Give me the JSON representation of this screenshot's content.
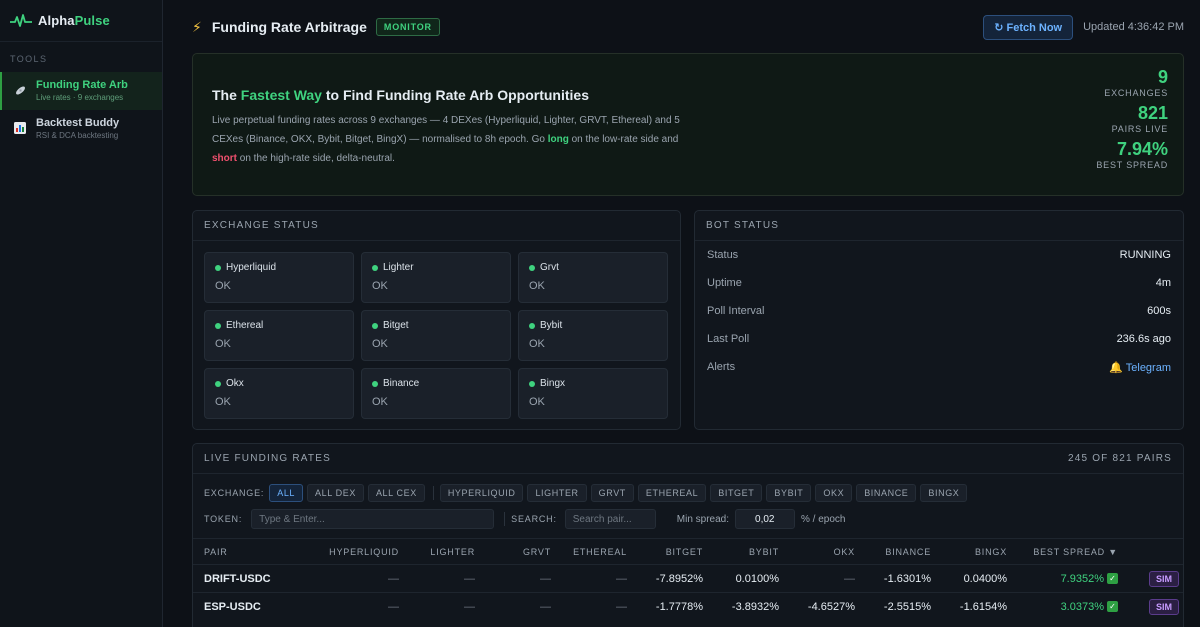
{
  "brand": {
    "name_a": "Alpha",
    "name_b": "Pulse"
  },
  "sidebar": {
    "section": "TOOLS",
    "items": [
      {
        "title": "Funding Rate Arb",
        "sub": "Live rates · 9 exchanges"
      },
      {
        "title": "Backtest Buddy",
        "sub": "RSI & DCA backtesting"
      }
    ]
  },
  "header": {
    "title": "Funding Rate Arbitrage",
    "badge": "MONITOR",
    "fetch_label": "↻ Fetch Now",
    "updated": "Updated 4:36:42 PM"
  },
  "hero": {
    "title_pre": "The ",
    "title_green": "Fastest Way",
    "title_post": " to Find Funding Rate Arb Opportunities",
    "desc_a": "Live perpetual funding rates across 9 exchanges — 4 DEXes (Hyperliquid, Lighter, GRVT, Ethereal) and 5 CEXes (Binance, OKX, Bybit, Bitget, BingX) — normalised to 8h epoch. Go ",
    "desc_long": "long",
    "desc_b": " on the low-rate side and ",
    "desc_short": "short",
    "desc_c": " on the high-rate side, delta-neutral.",
    "stats": [
      {
        "value": "9",
        "label": "EXCHANGES"
      },
      {
        "value": "821",
        "label": "PAIRS LIVE"
      },
      {
        "value": "7.94%",
        "label": "BEST SPREAD"
      }
    ]
  },
  "exchange_status": {
    "title": "EXCHANGE STATUS",
    "items": [
      {
        "name": "Hyperliquid",
        "status": "OK"
      },
      {
        "name": "Lighter",
        "status": "OK"
      },
      {
        "name": "Grvt",
        "status": "OK"
      },
      {
        "name": "Ethereal",
        "status": "OK"
      },
      {
        "name": "Bitget",
        "status": "OK"
      },
      {
        "name": "Bybit",
        "status": "OK"
      },
      {
        "name": "Okx",
        "status": "OK"
      },
      {
        "name": "Binance",
        "status": "OK"
      },
      {
        "name": "Bingx",
        "status": "OK"
      }
    ]
  },
  "bot_status": {
    "title": "BOT STATUS",
    "rows": [
      {
        "key": "Status",
        "value": "RUNNING"
      },
      {
        "key": "Uptime",
        "value": "4m"
      },
      {
        "key": "Poll Interval",
        "value": "600s"
      },
      {
        "key": "Last Poll",
        "value": "236.6s ago"
      },
      {
        "key": "Alerts",
        "value": "🔔 Telegram"
      }
    ]
  },
  "rates": {
    "title": "LIVE FUNDING RATES",
    "count": "245 OF 821 PAIRS",
    "exchange_label": "EXCHANGE:",
    "group_chips": [
      "ALL",
      "ALL DEX",
      "ALL CEX"
    ],
    "exchange_chips": [
      "HYPERLIQUID",
      "LIGHTER",
      "GRVT",
      "ETHEREAL",
      "BITGET",
      "BYBIT",
      "OKX",
      "BINANCE",
      "BINGX"
    ],
    "token_label": "TOKEN:",
    "token_placeholder": "Type & Enter...",
    "search_label": "SEARCH:",
    "search_placeholder": "Search pair...",
    "min_spread_label": "Min spread:",
    "min_spread_value": "0,02",
    "min_spread_unit": "% / epoch",
    "columns": [
      "PAIR",
      "HYPERLIQUID",
      "LIGHTER",
      "GRVT",
      "ETHEREAL",
      "BITGET",
      "BYBIT",
      "OKX",
      "BINANCE",
      "BINGX",
      "BEST SPREAD ▼",
      ""
    ],
    "sim_label": "SIM",
    "rows": [
      {
        "pair": "DRIFT-USDC",
        "cells": [
          "—",
          "—",
          "—",
          "—",
          "-7.8952%",
          "0.0100%",
          "—",
          "-1.6301%",
          "0.0400%"
        ],
        "best": "7.9352%"
      },
      {
        "pair": "ESP-USDC",
        "cells": [
          "—",
          "—",
          "—",
          "—",
          "-1.7778%",
          "-3.8932%",
          "-4.6527%",
          "-2.5515%",
          "-1.6154%"
        ],
        "best": "3.0373%"
      }
    ]
  },
  "colors": {
    "accent_green": "#3fd27f",
    "accent_blue": "#6cb2ff",
    "short_red": "#f0506e",
    "sim_purple": "#c79bff"
  }
}
